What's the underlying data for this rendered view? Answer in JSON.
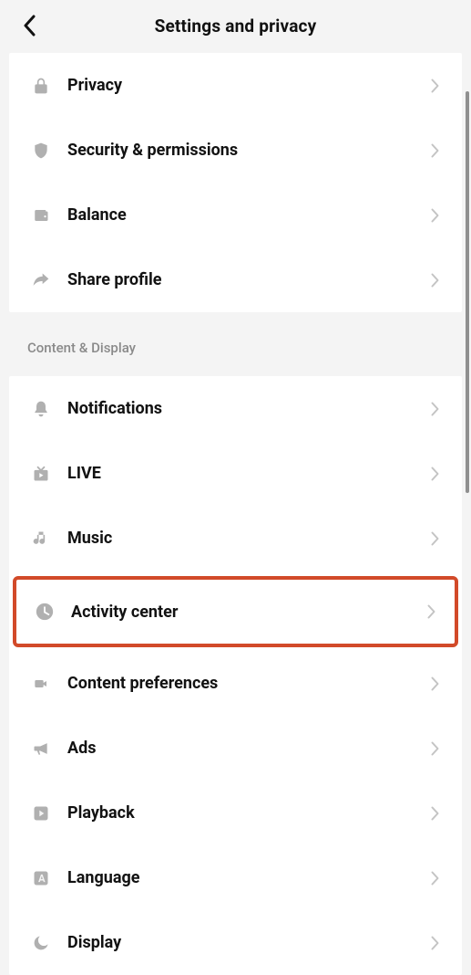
{
  "header": {
    "title": "Settings and privacy"
  },
  "section1": {
    "items": [
      {
        "label": "Privacy"
      },
      {
        "label": "Security & permissions"
      },
      {
        "label": "Balance"
      },
      {
        "label": "Share profile"
      }
    ]
  },
  "section2": {
    "heading": "Content & Display",
    "items": [
      {
        "label": "Notifications"
      },
      {
        "label": "LIVE"
      },
      {
        "label": "Music"
      },
      {
        "label": "Activity center"
      },
      {
        "label": "Content preferences"
      },
      {
        "label": "Ads"
      },
      {
        "label": "Playback"
      },
      {
        "label": "Language"
      },
      {
        "label": "Display"
      }
    ]
  }
}
